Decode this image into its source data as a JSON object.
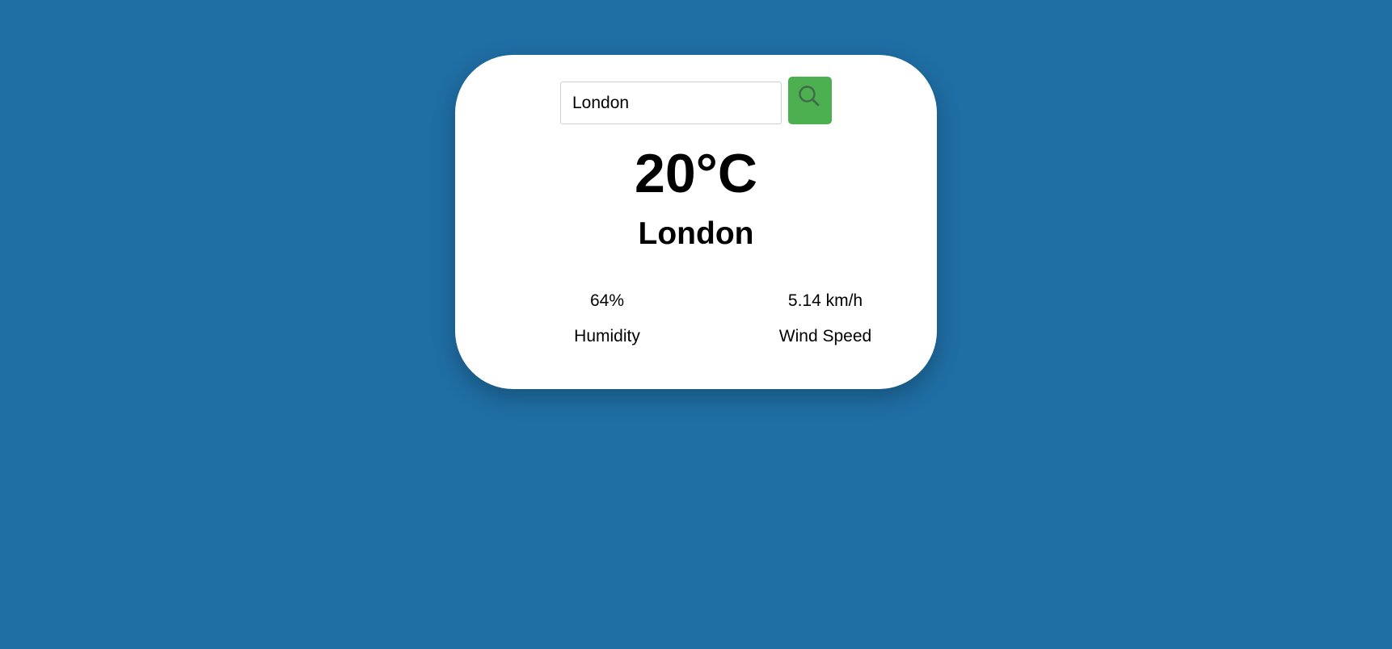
{
  "colors": {
    "background": "#1f6ea4",
    "card": "#ffffff",
    "search_button": "#4caf50",
    "search_icon": "#3f6b46"
  },
  "search": {
    "value": "London",
    "icon": "search-icon"
  },
  "weather": {
    "temperature": "20°C",
    "city": "London"
  },
  "details": {
    "humidity": {
      "value": "64%",
      "label": "Humidity"
    },
    "wind": {
      "value": "5.14 km/h",
      "label": "Wind Speed"
    }
  }
}
